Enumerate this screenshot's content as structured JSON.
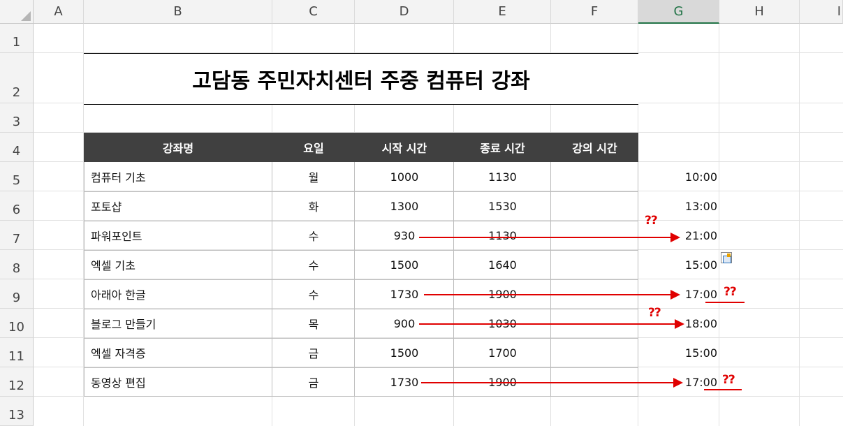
{
  "columns": [
    "A",
    "B",
    "C",
    "D",
    "E",
    "F",
    "G",
    "H",
    "I"
  ],
  "selected_column": "G",
  "rows": [
    "1",
    "2",
    "3",
    "4",
    "5",
    "6",
    "7",
    "8",
    "9",
    "10",
    "11",
    "12",
    "13"
  ],
  "title": "고담동 주민자치센터 주중 컴퓨터 강좌",
  "headers": [
    "강좌명",
    "요일",
    "시작 시간",
    "종료 시간",
    "강의 시간"
  ],
  "table": [
    {
      "name": "컴퓨터 기초",
      "day": "월",
      "start": "1000",
      "end": "1130",
      "g": "10:00"
    },
    {
      "name": "포토샵",
      "day": "화",
      "start": "1300",
      "end": "1530",
      "g": "13:00"
    },
    {
      "name": "파워포인트",
      "day": "수",
      "start": "930",
      "end": "1130",
      "g": "21:00"
    },
    {
      "name": "엑셀 기초",
      "day": "수",
      "start": "1500",
      "end": "1640",
      "g": "15:00"
    },
    {
      "name": "아래아 한글",
      "day": "수",
      "start": "1730",
      "end": "1900",
      "g": "17:00"
    },
    {
      "name": "블로그 만들기",
      "day": "목",
      "start": "900",
      "end": "1030",
      "g": "18:00"
    },
    {
      "name": "엑셀 자격증",
      "day": "금",
      "start": "1500",
      "end": "1700",
      "g": "15:00"
    },
    {
      "name": "동영상 편집",
      "day": "금",
      "start": "1730",
      "end": "1900",
      "g": "17:00"
    }
  ],
  "annotations": {
    "mark": "??",
    "color": "#e00000"
  },
  "colors": {
    "header_bg": "#404040",
    "selected_col_accent": "#217346"
  },
  "icons": [
    "paste-options-icon"
  ]
}
